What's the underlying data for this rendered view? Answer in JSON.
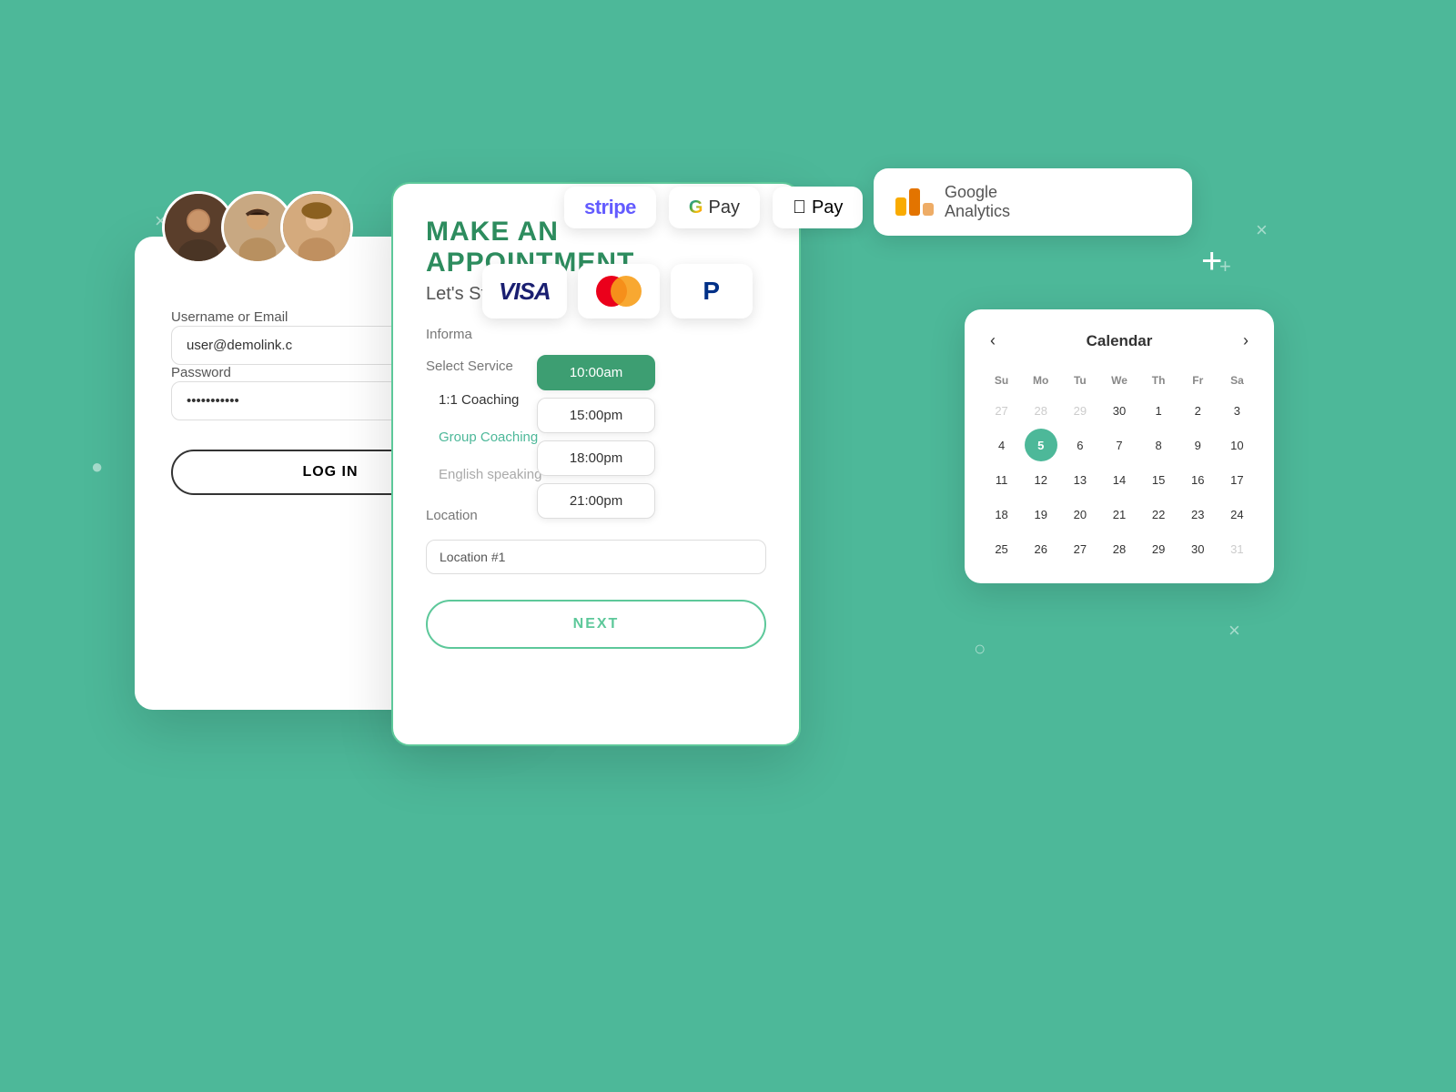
{
  "background": {
    "color": "#4db899"
  },
  "decorative": {
    "plus_label": "+",
    "x_label": "×",
    "o_label": "○"
  },
  "avatars": [
    {
      "id": 1,
      "emoji": "👨🏿",
      "alt": "Person 1"
    },
    {
      "id": 2,
      "emoji": "👩🏽",
      "alt": "Person 2"
    },
    {
      "id": 3,
      "emoji": "👨🏼",
      "alt": "Person 3"
    }
  ],
  "login": {
    "username_label": "Username or Email",
    "username_placeholder": "user@demolink.c",
    "password_label": "Password",
    "password_value": "••••••••••••",
    "button_label": "LOG IN"
  },
  "appointment": {
    "title": "MAKE AN APPOINTMENT",
    "subtitle": "Let's Start",
    "info_label": "Informa",
    "select_service_label": "Select Service",
    "services": [
      {
        "name": "1:1 Coaching",
        "style": "active"
      },
      {
        "name": "Group Coaching",
        "style": "secondary"
      },
      {
        "name": "English speaking",
        "style": "tertiary"
      }
    ],
    "location_label": "Location",
    "location_placeholder": "Location #1",
    "next_button": "NEXT"
  },
  "time_slots": [
    {
      "time": "10:00am",
      "active": true
    },
    {
      "time": "15:00pm",
      "active": false
    },
    {
      "time": "18:00pm",
      "active": false
    },
    {
      "time": "21:00pm",
      "active": false
    }
  ],
  "payment_badges": {
    "visa": "VISA",
    "mastercard": "MasterCard",
    "paypal": "P"
  },
  "top_payments": {
    "stripe": "stripe",
    "gpay_g": "G",
    "gpay_pay": "Pay",
    "apple_icon": "",
    "apple_pay": "Apple Pay"
  },
  "google_analytics": {
    "google": "Google",
    "analytics": "Analytics"
  },
  "calendar": {
    "title": "Calendar",
    "prev": "‹",
    "next": "›",
    "days_of_week": [
      "Su",
      "Mo",
      "Tu",
      "We",
      "Th",
      "Fr",
      "Sa"
    ],
    "weeks": [
      [
        {
          "day": 27,
          "other": true
        },
        {
          "day": 28,
          "other": true
        },
        {
          "day": 29,
          "other": true
        },
        {
          "day": 30,
          "other": false
        },
        {
          "day": 1,
          "other": false
        },
        {
          "day": 2,
          "other": false
        },
        {
          "day": 3,
          "other": false
        }
      ],
      [
        {
          "day": 4,
          "other": false
        },
        {
          "day": 5,
          "other": false
        },
        {
          "day": 6,
          "other": false
        },
        {
          "day": 7,
          "other": false
        },
        {
          "day": 8,
          "other": false
        },
        {
          "day": 9,
          "other": false
        },
        {
          "day": 10,
          "other": false
        }
      ],
      [
        {
          "day": 11,
          "other": false
        },
        {
          "day": 12,
          "other": false
        },
        {
          "day": 13,
          "other": false
        },
        {
          "day": 14,
          "other": false
        },
        {
          "day": 15,
          "other": false
        },
        {
          "day": 16,
          "other": false
        },
        {
          "day": 17,
          "other": false
        }
      ],
      [
        {
          "day": 18,
          "other": false
        },
        {
          "day": 19,
          "other": false
        },
        {
          "day": 20,
          "other": false
        },
        {
          "day": 21,
          "other": false
        },
        {
          "day": 22,
          "other": false
        },
        {
          "day": 23,
          "other": false
        },
        {
          "day": 24,
          "other": false
        }
      ],
      [
        {
          "day": 25,
          "other": false
        },
        {
          "day": 26,
          "other": false
        },
        {
          "day": 27,
          "other": false
        },
        {
          "day": 28,
          "other": false
        },
        {
          "day": 29,
          "other": false
        },
        {
          "day": 30,
          "other": false
        },
        {
          "day": 31,
          "other": true
        }
      ]
    ],
    "today": 5
  }
}
